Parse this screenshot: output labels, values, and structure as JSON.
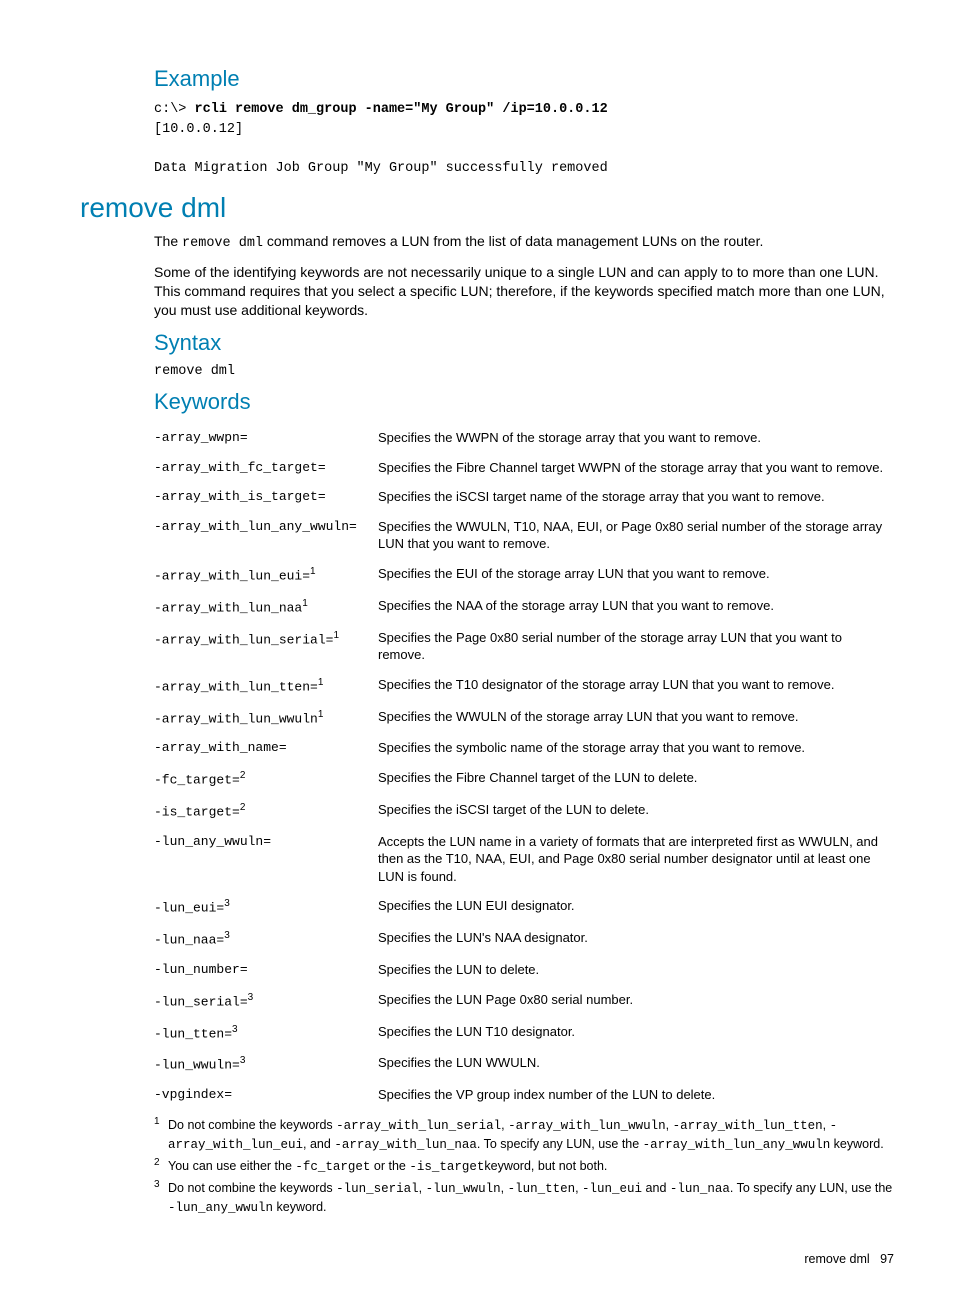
{
  "example": {
    "heading": "Example",
    "prompt": "c:\\> ",
    "command": "rcli remove dm_group -name=\"My Group\" /ip=10.0.0.12",
    "output_lines": [
      "[10.0.0.12]",
      "",
      "Data Migration Job Group \"My Group\" successfully removed"
    ]
  },
  "section": {
    "title": "remove dml",
    "intro_pre": "The ",
    "intro_cmd": "remove dml",
    "intro_post": " command removes a LUN from the list of data management LUNs on the router.",
    "para2": "Some of the identifying keywords are not necessarily unique to a single LUN and can apply to to more than one LUN. This command requires that you select a specific LUN; therefore, if the keywords specified match more than one LUN, you must use additional keywords."
  },
  "syntax": {
    "heading": "Syntax",
    "text": "remove dml"
  },
  "keywords": {
    "heading": "Keywords",
    "rows": [
      {
        "kw": "-array_wwpn=",
        "sup": "",
        "desc": "Specifies the WWPN of the storage array that you want to remove."
      },
      {
        "kw": "-array_with_fc_target=",
        "sup": "",
        "desc": "Specifies the Fibre Channel target WWPN of the storage array that you want to remove."
      },
      {
        "kw": "-array_with_is_target=",
        "sup": "",
        "desc": "Specifies the iSCSI target name of the storage array that you want to remove."
      },
      {
        "kw": "-array_with_lun_any_wwuln=",
        "sup": "",
        "desc": "Specifies the WWULN, T10, NAA, EUI, or Page 0x80 serial number of the storage array LUN that you want to remove."
      },
      {
        "kw": "-array_with_lun_eui=",
        "sup": "1",
        "desc": "Specifies the EUI of the storage array LUN that you want to remove."
      },
      {
        "kw": "-array_with_lun_naa",
        "sup": "1",
        "desc": "Specifies the NAA of the storage array LUN that you want to remove."
      },
      {
        "kw": "-array_with_lun_serial=",
        "sup": "1",
        "desc": "Specifies the Page 0x80 serial number of the storage array LUN that you want to remove."
      },
      {
        "kw": "-array_with_lun_tten=",
        "sup": "1",
        "desc": "Specifies the T10 designator of the storage array LUN that you want to remove."
      },
      {
        "kw": "-array_with_lun_wwuln",
        "sup": "1",
        "desc": "Specifies the WWULN of the storage array LUN that you want to remove."
      },
      {
        "kw": "-array_with_name=",
        "sup": "",
        "desc": "Specifies the symbolic name of the storage array that you want to remove."
      },
      {
        "kw": "-fc_target=",
        "sup": "2",
        "desc": "Specifies the Fibre Channel target of the LUN to delete."
      },
      {
        "kw": "-is_target=",
        "sup": "2",
        "desc": "Specifies the iSCSI target of the LUN to delete."
      },
      {
        "kw": "-lun_any_wwuln=",
        "sup": "",
        "desc": "Accepts the LUN name in a variety of formats that are interpreted first as WWULN, and then as the T10, NAA, EUI, and Page 0x80 serial number designator until at least one LUN is found."
      },
      {
        "kw": "-lun_eui=",
        "sup": "3",
        "desc": "Specifies the LUN EUI designator."
      },
      {
        "kw": "-lun_naa=",
        "sup": "3",
        "desc": "Specifies the LUN's NAA designator."
      },
      {
        "kw": "-lun_number=",
        "sup": "",
        "desc": "Specifies the LUN to delete."
      },
      {
        "kw": "-lun_serial=",
        "sup": "3",
        "desc": "Specifies the LUN Page 0x80 serial number."
      },
      {
        "kw": "-lun_tten=",
        "sup": "3",
        "desc": "Specifies the LUN T10 designator."
      },
      {
        "kw": "-lun_wwuln=",
        "sup": "3",
        "desc": "Specifies the LUN WWULN."
      },
      {
        "kw": "-vpgindex=",
        "sup": "",
        "desc": "Specifies the VP group index number of the LUN to delete."
      }
    ]
  },
  "footnotes": {
    "fn1": {
      "p1": "Do not combine the keywords ",
      "m1": "-array_with_lun_serial",
      "m2": "-array_with_lun_wwuln",
      "m3": "-array_with_lun_tten",
      "m4": "-array_with_lun_eui",
      "and": ", and ",
      "m5": "-array_with_lun_naa",
      "p2": ". To specify any LUN, use the ",
      "m6": "-array_with_lun_any_wwuln",
      "p3": " keyword."
    },
    "fn2": {
      "p1": "You can use either the ",
      "m1": "-fc_target",
      "p2": " or the ",
      "m2": "-is_target",
      "p3": "keyword, but not both."
    },
    "fn3": {
      "p1": "Do not combine the keywords ",
      "m1": "-lun_serial",
      "m2": "-lun_wwuln",
      "m3": "-lun_tten",
      "m4": "-lun_eui",
      "and": " and ",
      "m5": "-lun_naa",
      "p2": ". To specify any LUN, use the ",
      "m6": "-lun_any_wwuln",
      "p3": " keyword."
    }
  },
  "footer": {
    "label": "remove dml",
    "page": "97"
  }
}
